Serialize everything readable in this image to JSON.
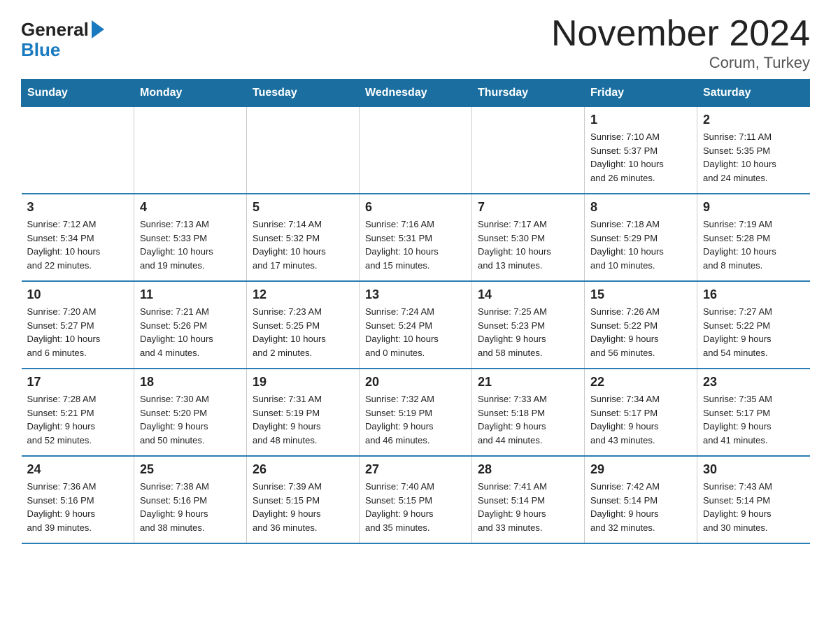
{
  "logo": {
    "general": "General",
    "blue": "Blue"
  },
  "title": "November 2024",
  "location": "Corum, Turkey",
  "weekdays": [
    "Sunday",
    "Monday",
    "Tuesday",
    "Wednesday",
    "Thursday",
    "Friday",
    "Saturday"
  ],
  "weeks": [
    [
      {
        "day": "",
        "info": ""
      },
      {
        "day": "",
        "info": ""
      },
      {
        "day": "",
        "info": ""
      },
      {
        "day": "",
        "info": ""
      },
      {
        "day": "",
        "info": ""
      },
      {
        "day": "1",
        "info": "Sunrise: 7:10 AM\nSunset: 5:37 PM\nDaylight: 10 hours\nand 26 minutes."
      },
      {
        "day": "2",
        "info": "Sunrise: 7:11 AM\nSunset: 5:35 PM\nDaylight: 10 hours\nand 24 minutes."
      }
    ],
    [
      {
        "day": "3",
        "info": "Sunrise: 7:12 AM\nSunset: 5:34 PM\nDaylight: 10 hours\nand 22 minutes."
      },
      {
        "day": "4",
        "info": "Sunrise: 7:13 AM\nSunset: 5:33 PM\nDaylight: 10 hours\nand 19 minutes."
      },
      {
        "day": "5",
        "info": "Sunrise: 7:14 AM\nSunset: 5:32 PM\nDaylight: 10 hours\nand 17 minutes."
      },
      {
        "day": "6",
        "info": "Sunrise: 7:16 AM\nSunset: 5:31 PM\nDaylight: 10 hours\nand 15 minutes."
      },
      {
        "day": "7",
        "info": "Sunrise: 7:17 AM\nSunset: 5:30 PM\nDaylight: 10 hours\nand 13 minutes."
      },
      {
        "day": "8",
        "info": "Sunrise: 7:18 AM\nSunset: 5:29 PM\nDaylight: 10 hours\nand 10 minutes."
      },
      {
        "day": "9",
        "info": "Sunrise: 7:19 AM\nSunset: 5:28 PM\nDaylight: 10 hours\nand 8 minutes."
      }
    ],
    [
      {
        "day": "10",
        "info": "Sunrise: 7:20 AM\nSunset: 5:27 PM\nDaylight: 10 hours\nand 6 minutes."
      },
      {
        "day": "11",
        "info": "Sunrise: 7:21 AM\nSunset: 5:26 PM\nDaylight: 10 hours\nand 4 minutes."
      },
      {
        "day": "12",
        "info": "Sunrise: 7:23 AM\nSunset: 5:25 PM\nDaylight: 10 hours\nand 2 minutes."
      },
      {
        "day": "13",
        "info": "Sunrise: 7:24 AM\nSunset: 5:24 PM\nDaylight: 10 hours\nand 0 minutes."
      },
      {
        "day": "14",
        "info": "Sunrise: 7:25 AM\nSunset: 5:23 PM\nDaylight: 9 hours\nand 58 minutes."
      },
      {
        "day": "15",
        "info": "Sunrise: 7:26 AM\nSunset: 5:22 PM\nDaylight: 9 hours\nand 56 minutes."
      },
      {
        "day": "16",
        "info": "Sunrise: 7:27 AM\nSunset: 5:22 PM\nDaylight: 9 hours\nand 54 minutes."
      }
    ],
    [
      {
        "day": "17",
        "info": "Sunrise: 7:28 AM\nSunset: 5:21 PM\nDaylight: 9 hours\nand 52 minutes."
      },
      {
        "day": "18",
        "info": "Sunrise: 7:30 AM\nSunset: 5:20 PM\nDaylight: 9 hours\nand 50 minutes."
      },
      {
        "day": "19",
        "info": "Sunrise: 7:31 AM\nSunset: 5:19 PM\nDaylight: 9 hours\nand 48 minutes."
      },
      {
        "day": "20",
        "info": "Sunrise: 7:32 AM\nSunset: 5:19 PM\nDaylight: 9 hours\nand 46 minutes."
      },
      {
        "day": "21",
        "info": "Sunrise: 7:33 AM\nSunset: 5:18 PM\nDaylight: 9 hours\nand 44 minutes."
      },
      {
        "day": "22",
        "info": "Sunrise: 7:34 AM\nSunset: 5:17 PM\nDaylight: 9 hours\nand 43 minutes."
      },
      {
        "day": "23",
        "info": "Sunrise: 7:35 AM\nSunset: 5:17 PM\nDaylight: 9 hours\nand 41 minutes."
      }
    ],
    [
      {
        "day": "24",
        "info": "Sunrise: 7:36 AM\nSunset: 5:16 PM\nDaylight: 9 hours\nand 39 minutes."
      },
      {
        "day": "25",
        "info": "Sunrise: 7:38 AM\nSunset: 5:16 PM\nDaylight: 9 hours\nand 38 minutes."
      },
      {
        "day": "26",
        "info": "Sunrise: 7:39 AM\nSunset: 5:15 PM\nDaylight: 9 hours\nand 36 minutes."
      },
      {
        "day": "27",
        "info": "Sunrise: 7:40 AM\nSunset: 5:15 PM\nDaylight: 9 hours\nand 35 minutes."
      },
      {
        "day": "28",
        "info": "Sunrise: 7:41 AM\nSunset: 5:14 PM\nDaylight: 9 hours\nand 33 minutes."
      },
      {
        "day": "29",
        "info": "Sunrise: 7:42 AM\nSunset: 5:14 PM\nDaylight: 9 hours\nand 32 minutes."
      },
      {
        "day": "30",
        "info": "Sunrise: 7:43 AM\nSunset: 5:14 PM\nDaylight: 9 hours\nand 30 minutes."
      }
    ]
  ]
}
